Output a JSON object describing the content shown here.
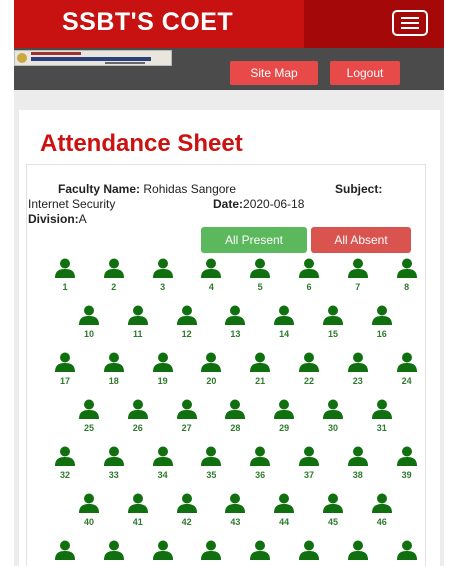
{
  "header": {
    "brand": "SSBT'S COET",
    "menu_icon": "hamburger-menu-icon",
    "logo_text": "COLLEGE OF ENGINEERING AND TECHNOLOGY",
    "nav": [
      {
        "label": "Site Map"
      },
      {
        "label": "Logout"
      }
    ],
    "colors": {
      "primary": "#c81212",
      "nav_button": "#e84a4a",
      "subbar": "#4b4b4b"
    }
  },
  "page": {
    "title": "Attendance Sheet",
    "faculty_label": "Faculty Name:",
    "faculty_value": "Rohidas Sangore",
    "subject_label": "Subject:",
    "subject_value": "Internet Security",
    "date_label": "Date:",
    "date_value": "2020-06-18",
    "division_label": "Division:",
    "division_value": "A",
    "all_present_label": "All Present",
    "all_absent_label": "All Absent",
    "colors": {
      "all_present": "#5cb85c",
      "all_absent": "#d9534f",
      "student_icon": "#107010"
    }
  },
  "students": {
    "icon": "person-icon",
    "rows": [
      [
        "1",
        "2",
        "3",
        "4",
        "5",
        "6",
        "7",
        "8"
      ],
      [
        "10",
        "11",
        "12",
        "13",
        "14",
        "15",
        "16"
      ],
      [
        "17",
        "18",
        "19",
        "20",
        "21",
        "22",
        "23",
        "24"
      ],
      [
        "25",
        "26",
        "27",
        "28",
        "29",
        "30",
        "31"
      ],
      [
        "32",
        "33",
        "34",
        "35",
        "36",
        "37",
        "38",
        "39"
      ],
      [
        "40",
        "41",
        "42",
        "43",
        "44",
        "45",
        "46"
      ]
    ]
  }
}
